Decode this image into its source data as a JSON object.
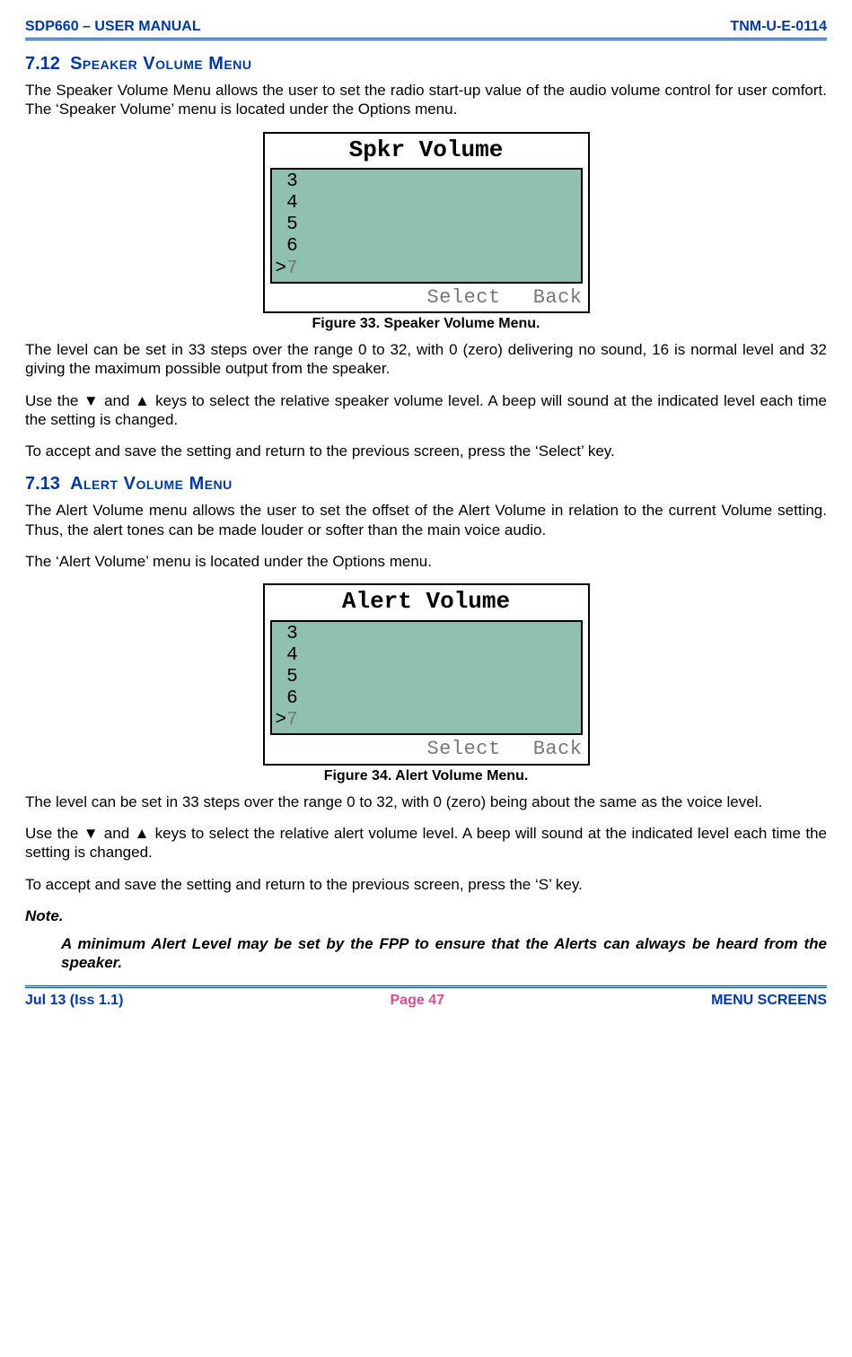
{
  "header": {
    "left": "SDP660 – USER MANUAL",
    "right": "TNM-U-E-0114"
  },
  "sec1": {
    "num": "7.12",
    "title": "Speaker Volume Menu",
    "p1": "The Speaker Volume Menu allows the user to set the radio start-up value of the audio volume control for user comfort.  The ‘Speaker Volume’ menu is located under the Options menu.",
    "lcd_title": "Spkr Volume",
    "items": [
      "3",
      "4",
      "5",
      "6",
      "7"
    ],
    "selected_index": 4,
    "soft_left": "Select",
    "soft_right": "Back",
    "caption": "Figure 33.  Speaker Volume Menu.",
    "p2": "The level can be set in 33 steps over the range 0 to 32, with 0 (zero) delivering no sound, 16 is normal level and 32 giving the maximum possible output from the speaker.",
    "p3": "Use the ▼ and ▲ keys to select the relative speaker volume level.  A beep will sound at the indicated level each time the setting is changed.",
    "p4": "To accept and save the setting and return to the previous screen, press the ‘Select’ key."
  },
  "sec2": {
    "num": "7.13",
    "title": "Alert Volume Menu",
    "p1": "The Alert Volume menu allows the user to set the offset of the Alert Volume in relation to the current Volume setting.  Thus, the alert tones can be made louder or softer than the main voice audio.",
    "p2": "The ‘Alert Volume’ menu is located under the Options menu.",
    "lcd_title": "Alert Volume",
    "items": [
      "3",
      "4",
      "5",
      "6",
      "7"
    ],
    "selected_index": 4,
    "soft_left": "Select",
    "soft_right": "Back",
    "caption": "Figure 34.  Alert Volume Menu.",
    "p3": "The level can be set in 33 steps over the range 0 to 32, with 0 (zero) being about the same as the voice level.",
    "p4": "Use the ▼ and ▲ keys to select the relative alert volume level.  A beep will sound at the indicated level each time the setting is changed.",
    "p5": "To accept and save the setting and return to the previous screen, press the ‘S’ key.",
    "note_head": "Note.",
    "note_body": "A minimum Alert Level may be set by the FPP to ensure that the Alerts can always be heard from the speaker."
  },
  "footer": {
    "left": "Jul 13 (Iss 1.1)",
    "center": "Page 47",
    "right": "MENU SCREENS"
  }
}
